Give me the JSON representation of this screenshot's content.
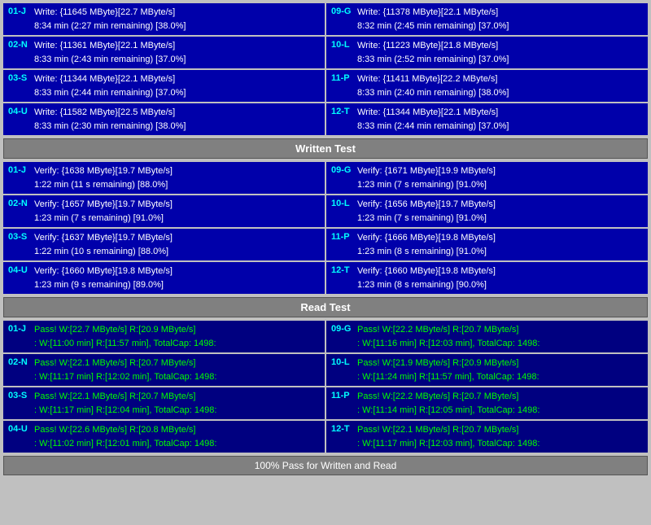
{
  "sections": {
    "write": {
      "label": "Written Test",
      "left": [
        {
          "id": "01-J",
          "line1": "Write: {11645 MByte}[22.7 MByte/s]",
          "line2": "8:34 min (2:27 min remaining)  [38.0%]"
        },
        {
          "id": "02-N",
          "line1": "Write: {11361 MByte}[22.1 MByte/s]",
          "line2": "8:33 min (2:43 min remaining)  [37.0%]"
        },
        {
          "id": "03-S",
          "line1": "Write: {11344 MByte}[22.1 MByte/s]",
          "line2": "8:33 min (2:44 min remaining)  [37.0%]"
        },
        {
          "id": "04-U",
          "line1": "Write: {11582 MByte}[22.5 MByte/s]",
          "line2": "8:33 min (2:30 min remaining)  [38.0%]"
        }
      ],
      "right": [
        {
          "id": "09-G",
          "line1": "Write: {11378 MByte}[22.1 MByte/s]",
          "line2": "8:32 min (2:45 min remaining)  [37.0%]"
        },
        {
          "id": "10-L",
          "line1": "Write: {11223 MByte}[21.8 MByte/s]",
          "line2": "8:33 min (2:52 min remaining)  [37.0%]"
        },
        {
          "id": "11-P",
          "line1": "Write: {11411 MByte}[22.2 MByte/s]",
          "line2": "8:33 min (2:40 min remaining)  [38.0%]"
        },
        {
          "id": "12-T",
          "line1": "Write: {11344 MByte}[22.1 MByte/s]",
          "line2": "8:33 min (2:44 min remaining)  [37.0%]"
        }
      ]
    },
    "verify": {
      "label": "Written Test",
      "left": [
        {
          "id": "01-J",
          "line1": "Verify: {1638 MByte}[19.7 MByte/s]",
          "line2": "1:22 min (11 s remaining)   [88.0%]"
        },
        {
          "id": "02-N",
          "line1": "Verify: {1657 MByte}[19.7 MByte/s]",
          "line2": "1:23 min (7 s remaining)   [91.0%]"
        },
        {
          "id": "03-S",
          "line1": "Verify: {1637 MByte}[19.7 MByte/s]",
          "line2": "1:22 min (10 s remaining)   [88.0%]"
        },
        {
          "id": "04-U",
          "line1": "Verify: {1660 MByte}[19.8 MByte/s]",
          "line2": "1:23 min (9 s remaining)   [89.0%]"
        }
      ],
      "right": [
        {
          "id": "09-G",
          "line1": "Verify: {1671 MByte}[19.9 MByte/s]",
          "line2": "1:23 min (7 s remaining)   [91.0%]"
        },
        {
          "id": "10-L",
          "line1": "Verify: {1656 MByte}[19.7 MByte/s]",
          "line2": "1:23 min (7 s remaining)   [91.0%]"
        },
        {
          "id": "11-P",
          "line1": "Verify: {1666 MByte}[19.8 MByte/s]",
          "line2": "1:23 min (8 s remaining)   [91.0%]"
        },
        {
          "id": "12-T",
          "line1": "Verify: {1660 MByte}[19.8 MByte/s]",
          "line2": "1:23 min (8 s remaining)   [90.0%]"
        }
      ]
    },
    "read": {
      "label": "Read Test",
      "left": [
        {
          "id": "01-J",
          "line1": "Pass! W:[22.7 MByte/s] R:[20.9 MByte/s]",
          "line2": ": W:[11:00 min] R:[11:57 min], TotalCap: 1498:"
        },
        {
          "id": "02-N",
          "line1": "Pass! W:[22.1 MByte/s] R:[20.7 MByte/s]",
          "line2": ": W:[11:17 min] R:[12:02 min], TotalCap: 1498:"
        },
        {
          "id": "03-S",
          "line1": "Pass! W:[22.1 MByte/s] R:[20.7 MByte/s]",
          "line2": ": W:[11:17 min] R:[12:04 min], TotalCap: 1498:"
        },
        {
          "id": "04-U",
          "line1": "Pass! W:[22.6 MByte/s] R:[20.8 MByte/s]",
          "line2": ": W:[11:02 min] R:[12:01 min], TotalCap: 1498:"
        }
      ],
      "right": [
        {
          "id": "09-G",
          "line1": "Pass! W:[22.2 MByte/s] R:[20.7 MByte/s]",
          "line2": ": W:[11:16 min] R:[12:03 min], TotalCap: 1498:"
        },
        {
          "id": "10-L",
          "line1": "Pass! W:[21.9 MByte/s] R:[20.9 MByte/s]",
          "line2": ": W:[11:24 min] R:[11:57 min], TotalCap: 1498:"
        },
        {
          "id": "11-P",
          "line1": "Pass! W:[22.2 MByte/s] R:[20.7 MByte/s]",
          "line2": ": W:[11:14 min] R:[12:05 min], TotalCap: 1498:"
        },
        {
          "id": "12-T",
          "line1": "Pass! W:[22.1 MByte/s] R:[20.7 MByte/s]",
          "line2": ": W:[11:17 min] R:[12:03 min], TotalCap: 1498:"
        }
      ]
    }
  },
  "headers": {
    "written_test": "Written Test",
    "read_test": "Read Test"
  },
  "footer": "100% Pass for Written and Read"
}
